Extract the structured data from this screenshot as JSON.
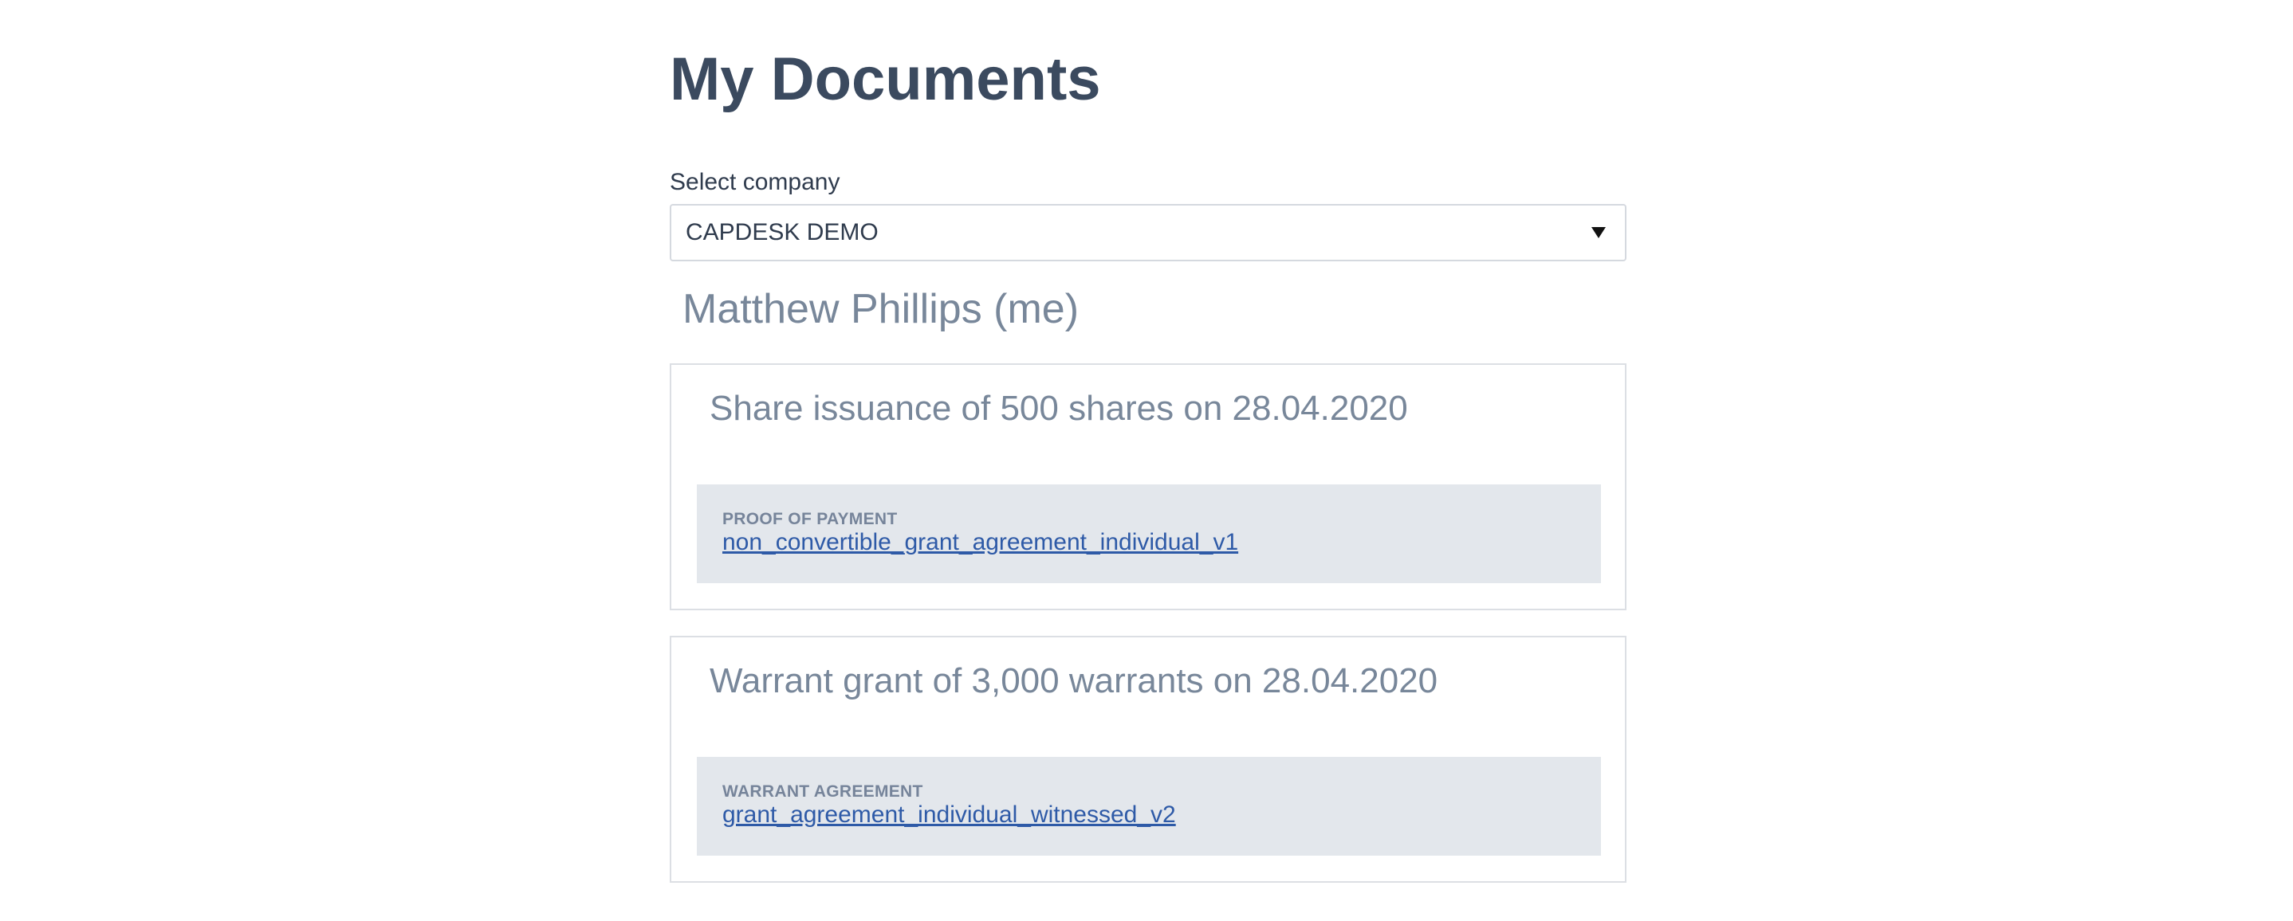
{
  "page": {
    "title": "My Documents"
  },
  "company_select": {
    "label": "Select company",
    "selected": "CAPDESK DEMO"
  },
  "person": {
    "name": "Matthew Phillips (me)"
  },
  "cards": [
    {
      "title": "Share issuance of 500 shares on 28.04.2020",
      "document": {
        "type": "PROOF OF PAYMENT",
        "filename": "non_convertible_grant_agreement_individual_v1"
      }
    },
    {
      "title": "Warrant grant of 3,000 warrants on 28.04.2020",
      "document": {
        "type": "WARRANT AGREEMENT",
        "filename": "grant_agreement_individual_witnessed_v2"
      }
    }
  ],
  "colors": {
    "title": "#3b4a5f",
    "muted": "#78879a",
    "link": "#2e5aa7",
    "doc_bg": "#e3e7ec",
    "border": "#dcdfe4"
  },
  "icons": {
    "select_caret": "triangle-down"
  }
}
